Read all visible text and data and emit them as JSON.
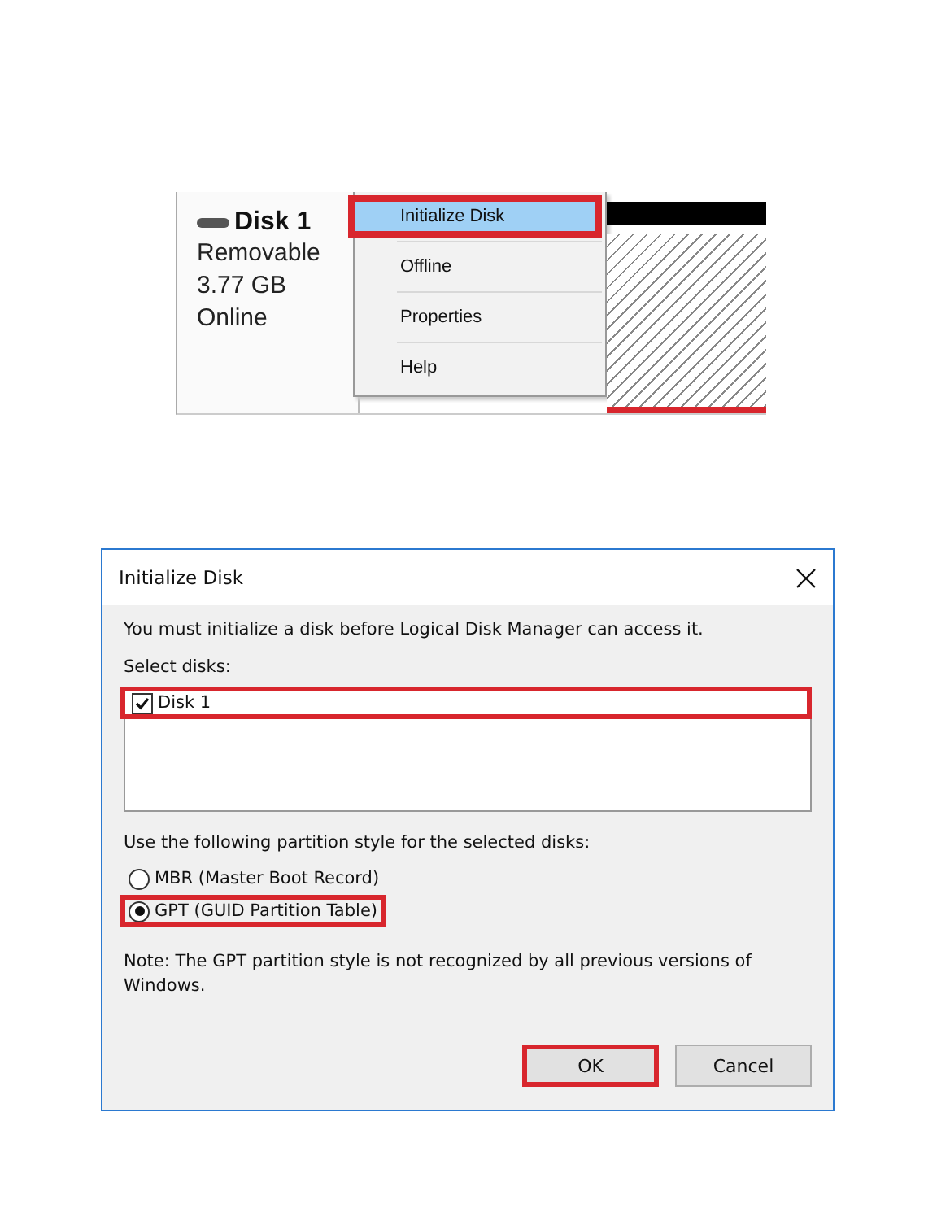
{
  "disk_panel": {
    "name": "Disk 1",
    "lines": [
      "Removable",
      "3.77 GB",
      "Online"
    ]
  },
  "context_menu": [
    {
      "label": "Initialize Disk",
      "highlighted": true
    },
    {
      "label": "Offline",
      "highlighted": false
    },
    {
      "label": "Properties",
      "highlighted": false
    },
    {
      "label": "Help",
      "highlighted": false
    }
  ],
  "dialog": {
    "title": "Initialize Disk",
    "message": "You must initialize a disk before Logical Disk Manager can access it.",
    "select_label": "Select disks:",
    "disks": [
      {
        "label": "Disk 1",
        "checked": true,
        "highlighted": true
      }
    ],
    "style_label": "Use the following partition style for the selected disks:",
    "options": [
      {
        "label": "MBR (Master Boot Record)",
        "selected": false,
        "highlighted": false
      },
      {
        "label": "GPT (GUID Partition Table)",
        "selected": true,
        "highlighted": true
      }
    ],
    "note": "Note: The GPT partition style is not recognized by all previous versions of Windows.",
    "buttons": [
      {
        "label": "OK",
        "highlighted": true
      },
      {
        "label": "Cancel",
        "highlighted": false
      }
    ]
  }
}
